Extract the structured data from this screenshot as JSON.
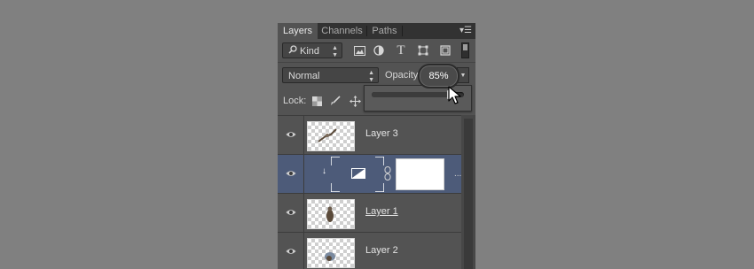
{
  "tabs": [
    {
      "label": "Layers",
      "active": true
    },
    {
      "label": "Channels",
      "active": false
    },
    {
      "label": "Paths",
      "active": false
    }
  ],
  "filter": {
    "kind_label": "Kind",
    "icons": [
      "search-icon",
      "image-icon",
      "adjustment-icon",
      "text-icon",
      "shape-icon",
      "smart-object-icon",
      "toggle-icon"
    ]
  },
  "blend_mode": "Normal",
  "opacity": {
    "label": "Opacity:",
    "value": "85%",
    "level": 0.85
  },
  "lock": {
    "label": "Lock:",
    "icons": [
      "lock-pixels-icon",
      "lock-brush-icon",
      "lock-move-icon"
    ]
  },
  "layers": [
    {
      "name": "Layer 3",
      "selected": false,
      "type": "pixel"
    },
    {
      "name": "",
      "selected": true,
      "type": "adjustment",
      "extra": "..."
    },
    {
      "name": "Layer 1",
      "selected": false,
      "type": "pixel"
    },
    {
      "name": "Layer 2",
      "selected": false,
      "type": "pixel"
    }
  ],
  "colors": {
    "panel": "#535353",
    "tabbar": "#323232",
    "selected": "#4d5b79",
    "background": "#808080"
  }
}
